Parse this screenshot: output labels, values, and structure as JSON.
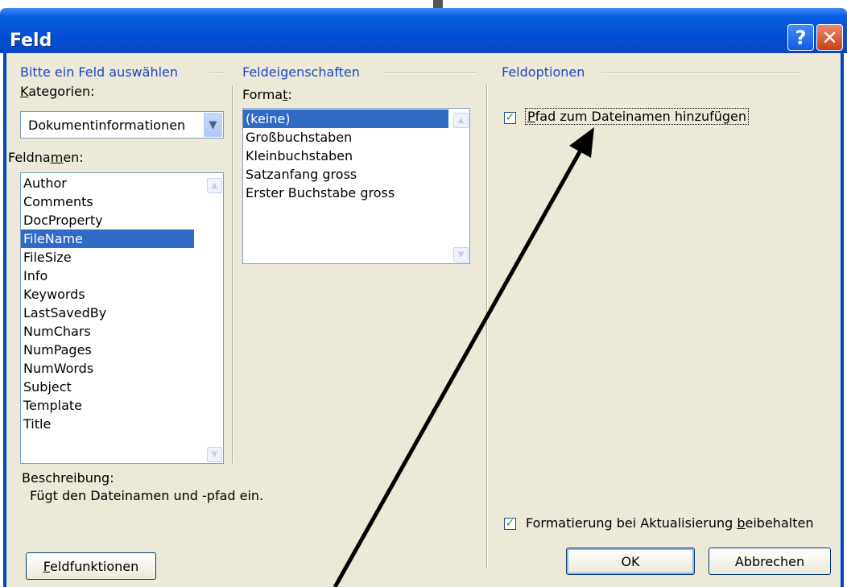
{
  "window": {
    "title": "Feld",
    "help_glyph": "?",
    "close_glyph": "✕"
  },
  "left": {
    "group_title": "Bitte ein Feld auswählen",
    "categories_label_u": "K",
    "categories_label_rest": "ategorien:",
    "category_value": "Dokumentinformationen",
    "fieldnames_label_pre": "Feldna",
    "fieldnames_label_u": "m",
    "fieldnames_label_post": "en:",
    "fieldnames": [
      "Author",
      "Comments",
      "DocProperty",
      "FileName",
      "FileSize",
      "Info",
      "Keywords",
      "LastSavedBy",
      "NumChars",
      "NumPages",
      "NumWords",
      "Subject",
      "Template",
      "Title"
    ],
    "selected_fieldname": "FileName",
    "description_label": "Beschreibung:",
    "description_text": "Fügt den Dateinamen und -pfad ein.",
    "field_codes_button_u": "F",
    "field_codes_button_rest": "eldfunktionen"
  },
  "middle": {
    "group_title": "Feldeigenschaften",
    "format_label_pre": "Forma",
    "format_label_u": "t",
    "format_label_post": ":",
    "formats": [
      "(keine)",
      "Großbuchstaben",
      "Kleinbuchstaben",
      "Satzanfang gross",
      "Erster Buchstabe gross"
    ],
    "selected_format": "(keine)"
  },
  "right": {
    "group_title": "Feldoptionen",
    "add_path_u": "P",
    "add_path_rest": "fad zum Dateinamen hinzufügen",
    "add_path_checked": true,
    "preserve_pre": "Formatierung bei Aktualisierung ",
    "preserve_u": "b",
    "preserve_post": "eibehalten",
    "preserve_checked": true,
    "ok_label": "OK",
    "cancel_label": "Abbrechen"
  },
  "colors": {
    "title_bar": "#0550d8",
    "selection": "#316ac5",
    "group_title": "#1f47c2",
    "dialog_face": "#ece9d8",
    "checkmark": "#21a121"
  }
}
